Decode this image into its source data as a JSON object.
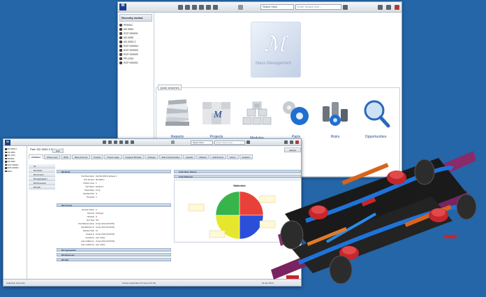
{
  "back_window": {
    "select_view": "Select View",
    "search_placeholder": "Enter Search text ...",
    "recently_visited": {
      "title": "Recently visited",
      "items": [
        "PR0001",
        "M2-3000",
        "RCP-000001",
        "M2-3050",
        "M2-3000-2",
        "RCP-000004",
        "RCP-000003",
        "RCP-000002",
        "PR-1234",
        "RCP-000001"
      ]
    },
    "logo_text": "Mass Management",
    "quick_searches": {
      "title": "Quick searches",
      "items": [
        "Reports",
        "Projects",
        "Modules",
        "Parts",
        "Risks",
        "Opportunities"
      ]
    }
  },
  "front_window": {
    "select_view": "Select View",
    "search_placeholder": "Enter Search text ...",
    "part_title": "Part: M2-3000-2 Exhaust 2",
    "edit_label": "Edit",
    "actions_label": "Actions",
    "left_items": [
      "M2-3000-2",
      "M2-3050",
      "PR-1234",
      "PR0001",
      "M2-3000",
      "RCP-000001",
      "RCP-000004",
      "Risks"
    ],
    "nav_items": [
      "All",
      "M2 Detail",
      "M2 Content",
      "M2 Aggregation",
      "M2 Dimension",
      "M2 LWL"
    ],
    "tabs": [
      "Attributes",
      "Where used",
      "BOM",
      "Mass (Current)",
      "Projects",
      "Project usage",
      "Assigned Modules",
      "Changes",
      "Risk & Opportunities",
      "Supplier",
      "Material",
      "Attachments",
      "History",
      "Analytics"
    ],
    "sections": {
      "detail": "M2 Detail",
      "content": "M2 Content",
      "aggregation": "M2 Aggregation",
      "dimension": "M2 Dimension",
      "lwl": "M2 LWL",
      "chart_mass_history": "Chart Mass History",
      "chart_materials": "Chart Materials"
    },
    "detail_fields": [
      {
        "label": "Part Description",
        "value": "Part M2-3000-2 Exhaust 2"
      },
      {
        "label": "Part Number",
        "value": "M2-3000-2"
      },
      {
        "label": "Product Lines",
        "value": "2"
      },
      {
        "label": "Part Name",
        "value": "Exhaust 2"
      },
      {
        "label": "Target Mass",
        "value": "10 kg"
      },
      {
        "label": "Standard Part",
        "value": "✖"
      },
      {
        "label": "Threshold",
        "value": "2"
      }
    ],
    "content_fields": [
      {
        "label": "Revision Name",
        "value": "A"
      },
      {
        "label": "Lifecycle",
        "value": "Prototype"
      },
      {
        "label": "Obsolete",
        "value": "✖"
      },
      {
        "label": "Sort Type",
        "value": "P/S"
      },
      {
        "label": "Part Effective Since",
        "value": "01-Apr-2014 (04:49:53)"
      },
      {
        "label": "Part Effective To",
        "value": "01-Apr-2014 (04:49:53)"
      },
      {
        "label": "Release Date",
        "value": "01"
      },
      {
        "label": "Created at",
        "value": "01-Apr-2014 (04:49:53)"
      },
      {
        "label": "Created by",
        "value": "auto -admin"
      },
      {
        "label": "Last modified on",
        "value": "01-Apr-2014 (04:49:53)"
      },
      {
        "label": "Last modified by",
        "value": "auto -admin"
      }
    ],
    "chart_title": "Materials",
    "status": {
      "left": "Collection Summary",
      "center": "Version Application Process (4.0.01)",
      "right": "01-Apr-2014"
    },
    "accent": "#1b3f86"
  },
  "chart_data": {
    "type": "pie",
    "title": "Materials",
    "categories": [
      "Material A",
      "Material B",
      "Material C",
      "Material D"
    ],
    "values": [
      25,
      25,
      25,
      25
    ],
    "colors": [
      "#e8413a",
      "#2b4fd8",
      "#e6e72c",
      "#37b54a"
    ]
  },
  "background": "#2466a8"
}
